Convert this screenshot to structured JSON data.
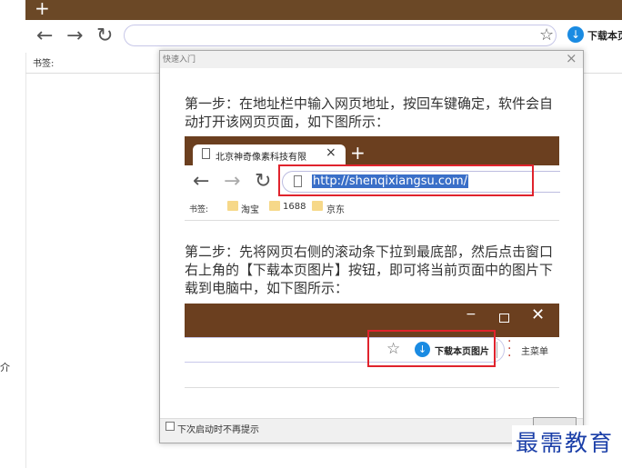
{
  "browser": {
    "new_tab_symbol": "+",
    "back": "←",
    "forward": "→",
    "reload": "↻",
    "star": "☆",
    "download_label": "下载本页",
    "bookmarks_label": "书签:",
    "left_edge_char": "介"
  },
  "dialog": {
    "title": "快速入门",
    "close_symbol": "×",
    "step1_text": "第一步：在地址栏中输入网页地址，按回车键确定，软件会自动打开该网页页面，如下图所示：",
    "step2_text": "第二步：先将网页右侧的滚动条下拉到最底部，然后点击窗口右上角的【下载本页图片】按钮，即可将当前页面中的图片下载到电脑中，如下图所示：",
    "illustration1": {
      "tab_title": "北京神奇像素科技有限",
      "tab_close": "×",
      "new_tab": "+",
      "back": "←",
      "forward": "→",
      "reload": "↻",
      "url": "http://shenqixiangsu.com/",
      "bookmarks_label": "书签:",
      "bookmarks": [
        "淘宝",
        "1688",
        "京东"
      ]
    },
    "illustration2": {
      "minimize": "−",
      "close": "✕",
      "star": "☆",
      "download_label": "下载本页图片",
      "menu_label": "主菜单"
    },
    "dont_show_label": "下次启动时不再提示",
    "ok_label": ""
  },
  "watermark": "最需教育",
  "colors": {
    "tab_bar": "#6b4826",
    "illustration_bar": "#6b3f1f",
    "highlight_red": "#e0232d",
    "download_blue": "#1a8be2",
    "watermark_blue": "#1b3fa8"
  }
}
